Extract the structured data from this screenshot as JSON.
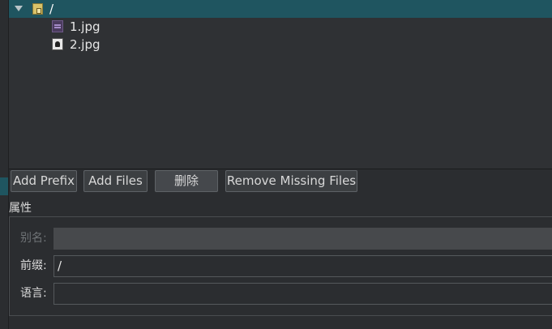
{
  "tree": {
    "root": {
      "label": "/",
      "icon": "folder-lock-icon"
    },
    "files": [
      {
        "label": "1.jpg",
        "icon": "image-file-icon"
      },
      {
        "label": "2.jpg",
        "icon": "image-file-icon"
      }
    ]
  },
  "toolbar": {
    "add_prefix": "Add Prefix",
    "add_files": "Add Files",
    "delete": "删除",
    "remove_missing": "Remove Missing Files"
  },
  "properties": {
    "title": "属性",
    "alias_label": "别名:",
    "alias_value": "",
    "prefix_label": "前缀:",
    "prefix_value": "/",
    "language_label": "语言:",
    "language_value": ""
  },
  "colors": {
    "selection": "#1f5560",
    "background": "#2b2d30"
  }
}
